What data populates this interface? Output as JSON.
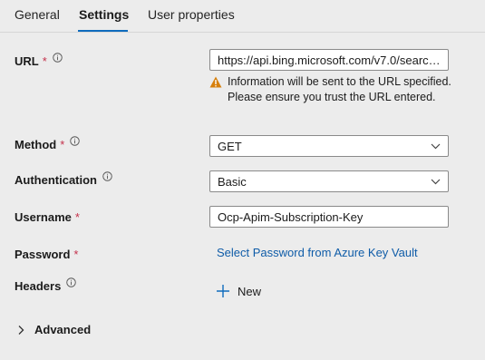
{
  "tabs": [
    {
      "label": "General"
    },
    {
      "label": "Settings",
      "active": true
    },
    {
      "label": "User properties"
    }
  ],
  "required_marker": "*",
  "fields": {
    "url": {
      "label": "URL",
      "required": true,
      "value": "https://api.bing.microsoft.com/v7.0/search?q=…"
    },
    "warning": "Information will be sent to the URL specified. Please ensure you trust the URL entered.",
    "method": {
      "label": "Method",
      "required": true,
      "value": "GET"
    },
    "authentication": {
      "label": "Authentication",
      "value": "Basic"
    },
    "username": {
      "label": "Username",
      "required": true,
      "value": "Ocp-Apim-Subscription-Key"
    },
    "password": {
      "label": "Password",
      "required": true,
      "link": "Select Password from Azure Key Vault"
    },
    "headers": {
      "label": "Headers",
      "new_label": "New"
    }
  },
  "advanced": {
    "label": "Advanced"
  },
  "colors": {
    "accent": "#0f6cbd",
    "required": "#c4314b",
    "warning": "#d67f0c",
    "link": "#0f5ca8"
  }
}
